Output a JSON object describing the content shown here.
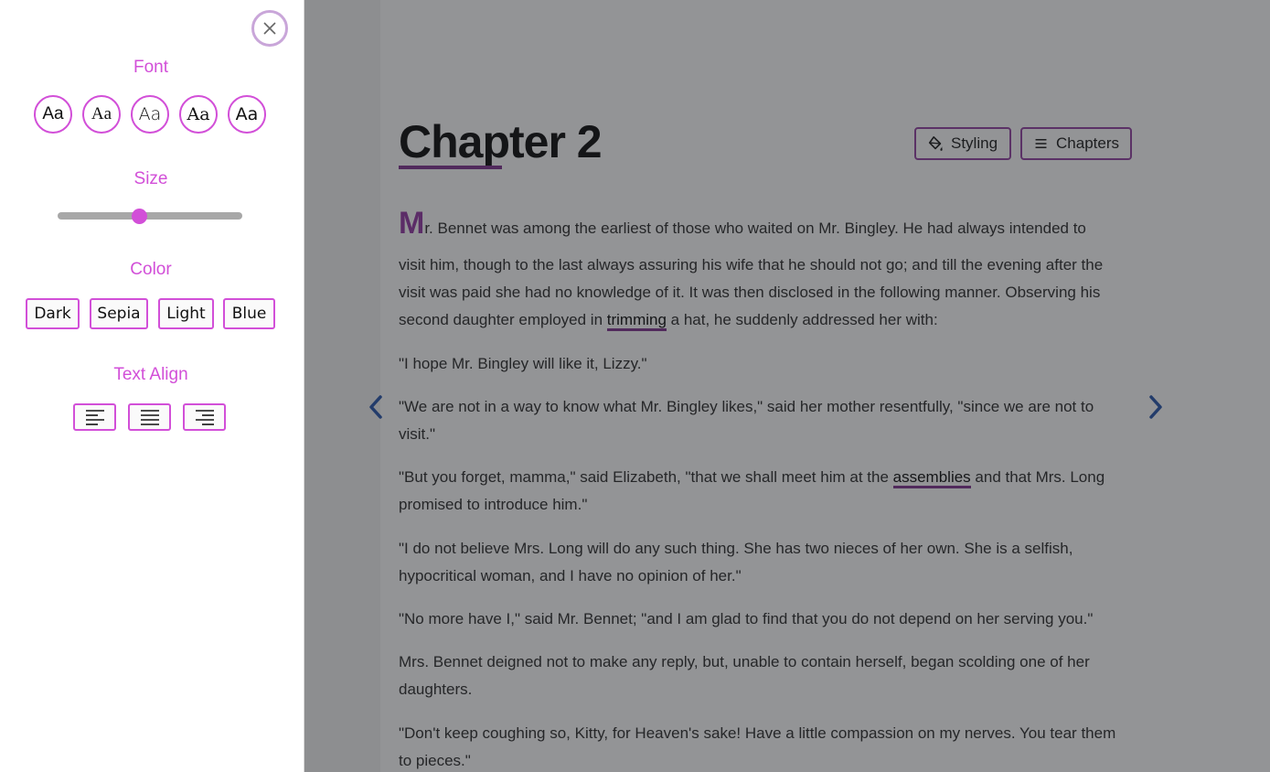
{
  "panel": {
    "font_label": "Font",
    "font_options": [
      "Aa",
      "Aa",
      "Aa",
      "Aa",
      "Aa"
    ],
    "size_label": "Size",
    "size_value": 0.44,
    "color_label": "Color",
    "color_options": [
      "Dark",
      "Sepia",
      "Light",
      "Blue"
    ],
    "align_label": "Text Align",
    "align_options": [
      "align-left-icon",
      "align-justify-icon",
      "align-right-icon"
    ],
    "accent_color": "#d24fd8"
  },
  "reader": {
    "chapter_title": "Chapter 2",
    "styling_label": "Styling",
    "chapters_label": "Chapters",
    "dropcap": "M",
    "p1_rest_a": "r. Bennet was among the earliest of those who waited on Mr. Bingley. He had always intended to",
    "p1_rest_b": "visit him, though to the last always assuring his wife that he should not go; and till the evening after the visit was paid she had no knowledge of it. It was then disclosed in the following manner. Observing his second daughter employed in ",
    "p1_highlight": "trimming",
    "p1_tail": " a hat, he suddenly addressed her with:",
    "p2": "\"I hope Mr. Bingley will like it, Lizzy.\"",
    "p3": "\"We are not in a way to know what Mr. Bingley likes,\" said her mother resentfully, \"since we are not to visit.\"",
    "p4_head": "\"But you forget, mamma,\" said Elizabeth, \"that we shall meet him at the ",
    "p4_highlight": "assemblies",
    "p4_tail": " and that Mrs. Long promised to introduce him.\"",
    "p5": "\"I do not believe Mrs. Long will do any such thing. She has two nieces of her own. She is a selfish, hypocritical woman, and I have no opinion of her.\"",
    "p6": "\"No more have I,\" said Mr. Bennet; \"and I am glad to find that you do not depend on her serving you.\"",
    "p7": "Mrs. Bennet deigned not to make any reply, but, unable to contain herself, began scolding one of her daughters.",
    "p8": "\"Don't keep coughing so, Kitty, for Heaven's sake! Have a little compassion on my nerves. You tear them to pieces.\"",
    "highlight_color": "#7a2a8a",
    "nav_color": "#1f4fa8"
  }
}
